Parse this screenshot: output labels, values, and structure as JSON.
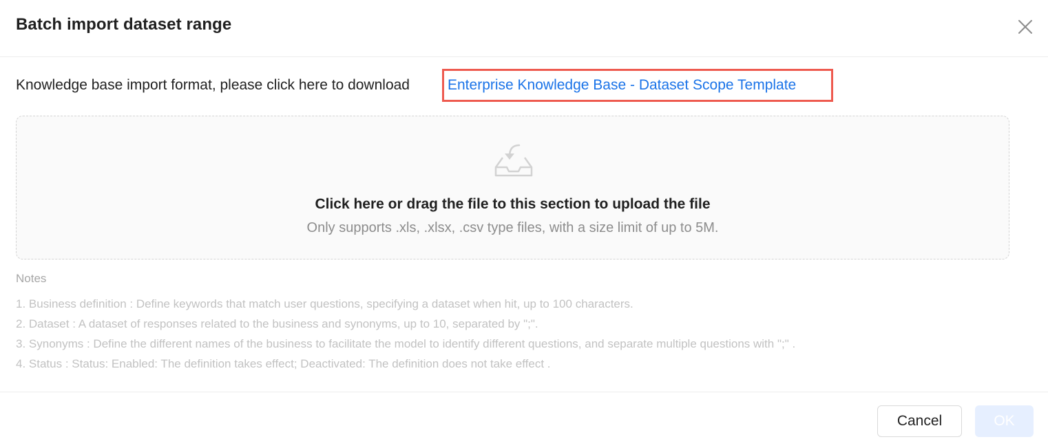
{
  "dialog": {
    "title": "Batch import dataset range",
    "close_icon": "close-icon"
  },
  "download": {
    "prefix": "Knowledge base import format, please click here to download",
    "link_text": "Enterprise Knowledge Base - Dataset Scope Template",
    "highlight_color": "#ee5a4f",
    "link_color": "#1a73e8"
  },
  "upload": {
    "icon": "inbox-upload-icon",
    "title": "Click here or drag the file to this section to upload the file",
    "hint": "Only supports .xls, .xlsx, .csv type files, with a size limit of up to 5M."
  },
  "notes": {
    "title": "Notes",
    "items": [
      "1. Business definition : Define keywords that match user questions, specifying a dataset when hit, up to 100 characters.",
      "2. Dataset : A dataset of responses related to the business and synonyms, up to 10, separated by \";\".",
      "3. Synonyms : Define the different names of the business to facilitate the model to identify different questions, and separate multiple questions with \";\" .",
      "4. Status : Status: Enabled: The definition takes effect; Deactivated: The definition does not take effect ."
    ]
  },
  "footer": {
    "cancel_label": "Cancel",
    "ok_label": "OK",
    "ok_disabled": true
  }
}
